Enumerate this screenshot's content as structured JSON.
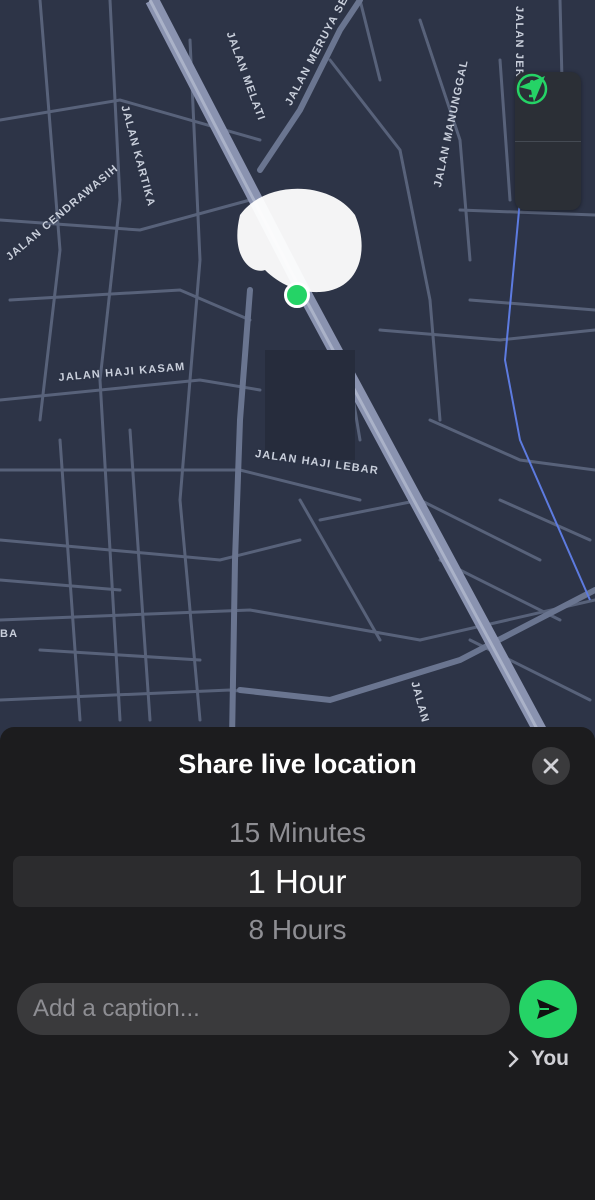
{
  "map": {
    "street_labels": [
      "JALAN MERUYA SELA",
      "JALAN MELATI",
      "JALAN JER",
      "JALAN KARTIKA",
      "JALAN MANUNGGAL",
      "JALAN CENDRAWASIH",
      "JALAN HAJI KASAM",
      "JALAN HAJI LEBAR",
      "JALAN",
      "BA"
    ],
    "controls": {
      "info_icon": "info-icon",
      "locate_icon": "navigation-arrow-icon",
      "accent_color": "#25d366"
    }
  },
  "sheet": {
    "title": "Share live location",
    "close_icon": "close-icon",
    "durations": [
      "15 Minutes",
      "1 Hour",
      "8 Hours"
    ],
    "selected_duration": "1 Hour",
    "caption_placeholder": "Add a caption...",
    "send_icon": "send-icon",
    "recipient_label": "You",
    "recipient_icon": "chevron-right-icon"
  }
}
